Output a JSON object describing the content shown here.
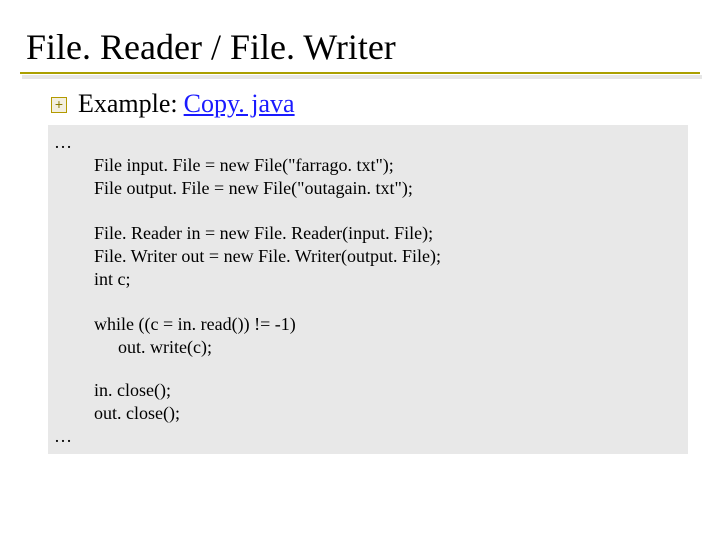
{
  "title": "File. Reader / File. Writer",
  "bullet": {
    "prefix": "Example: ",
    "link": "Copy. java"
  },
  "code": {
    "top_ellipsis": "…",
    "block1": "File input. File = new File(\"farrago. txt\");\nFile output. File = new File(\"outagain. txt\");",
    "block2": "File. Reader in = new File. Reader(input. File);\nFile. Writer out = new File. Writer(output. File);\nint c;",
    "while_head": "while ((c = in. read()) != -1)",
    "while_body": "out. write(c);",
    "block4": "in. close();\nout. close();",
    "bot_ellipsis": "…"
  }
}
